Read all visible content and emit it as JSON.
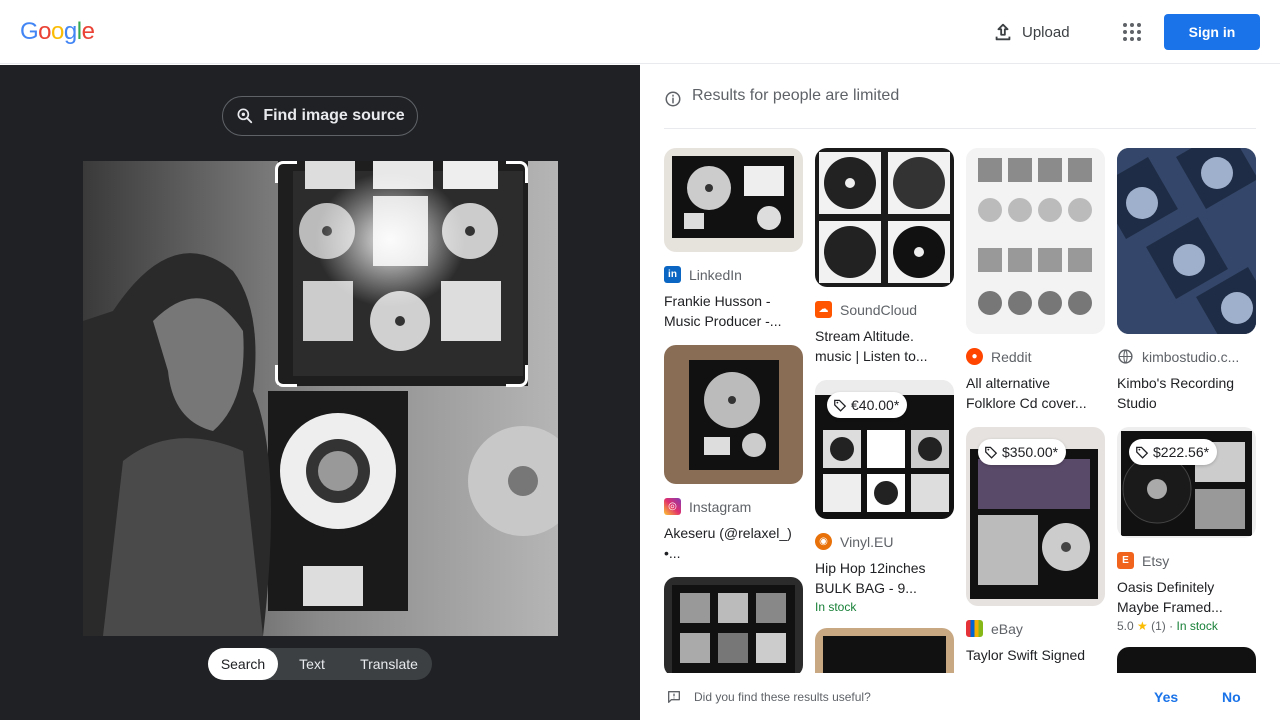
{
  "header": {
    "logo_letters": [
      "G",
      "o",
      "o",
      "g",
      "l",
      "e"
    ],
    "logo_colors": [
      "#4285F4",
      "#EA4335",
      "#FBBC05",
      "#4285F4",
      "#34A853",
      "#EA4335"
    ],
    "upload_label": "Upload",
    "signin_label": "Sign in"
  },
  "left": {
    "find_source_label": "Find image source",
    "mode_tabs": [
      {
        "label": "Search",
        "active": true
      },
      {
        "label": "Text",
        "active": false
      },
      {
        "label": "Translate",
        "active": false
      }
    ]
  },
  "results": {
    "notice": "Results for people are limited",
    "columns": [
      [
        {
          "source": "LinkedIn",
          "source_icon": "linkedin-icon",
          "source_color": "#0a66c2",
          "title": "Frankie Husson - Music Producer -..."
        },
        {
          "source": "Instagram",
          "source_icon": "instagram-icon",
          "source_color": "#d6249f",
          "title": "Akeseru (@relaxel_) •..."
        },
        {
          "source": "",
          "source_icon": "",
          "source_color": "",
          "title": ""
        }
      ],
      [
        {
          "source": "SoundCloud",
          "source_icon": "soundcloud-icon",
          "source_color": "#ff5500",
          "title": "Stream Altitude. music | Listen to..."
        },
        {
          "source": "Vinyl.EU",
          "source_icon": "vinyl-eu-icon",
          "source_color": "#e8710a",
          "title": "Hip Hop 12inches BULK BAG - 9...",
          "price": "€40.00*",
          "stock": "In stock"
        },
        {
          "source": "",
          "source_icon": "",
          "source_color": "",
          "title": ""
        }
      ],
      [
        {
          "source": "Reddit",
          "source_icon": "reddit-icon",
          "source_color": "#ff4500",
          "title": "All alternative Folklore Cd cover..."
        },
        {
          "source": "eBay",
          "source_icon": "ebay-icon",
          "source_color": "#e53238",
          "title": "Taylor Swift Signed",
          "price": "$350.00*"
        }
      ],
      [
        {
          "source": "kimbostudio.c...",
          "source_icon": "globe-icon",
          "source_color": "#5f6368",
          "title": "Kimbo's Recording Studio"
        },
        {
          "source": "Etsy",
          "source_icon": "etsy-icon",
          "source_color": "#f1641e",
          "title": "Oasis Definitely Maybe Framed...",
          "price": "$222.56*",
          "rating": "5.0",
          "rating_count": "(1)",
          "stock": "In stock"
        },
        {
          "source": "",
          "source_icon": "",
          "source_color": "",
          "title": ""
        }
      ]
    ]
  },
  "feedback": {
    "question": "Did you find these results useful?",
    "yes": "Yes",
    "no": "No"
  }
}
